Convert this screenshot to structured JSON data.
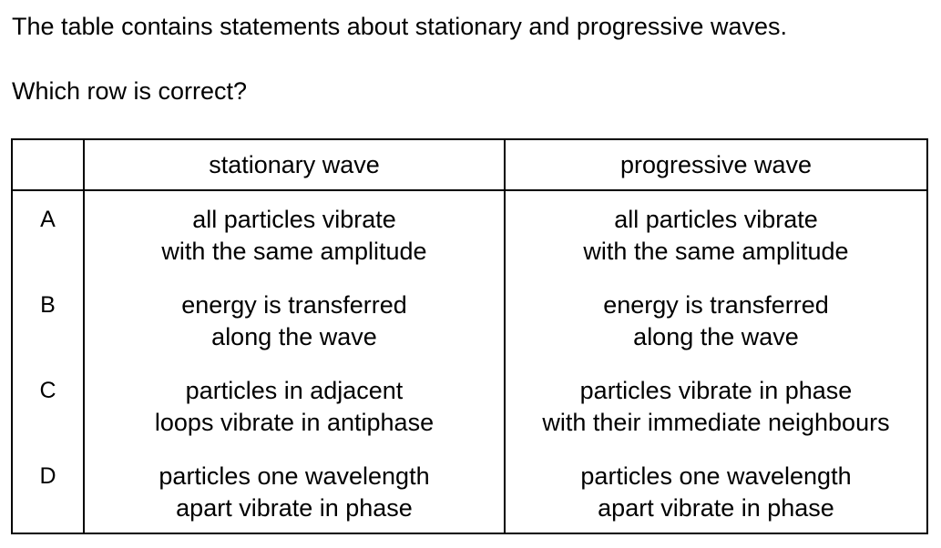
{
  "intro": "The table contains statements about stationary and progressive waves.",
  "question": "Which row is correct?",
  "table": {
    "headers": [
      "",
      "stationary wave",
      "progressive wave"
    ],
    "rows": [
      {
        "letter": "A",
        "stationary": [
          "all particles vibrate",
          "with the same amplitude"
        ],
        "progressive": [
          "all particles vibrate",
          "with the same amplitude"
        ]
      },
      {
        "letter": "B",
        "stationary": [
          "energy is transferred",
          "along the wave"
        ],
        "progressive": [
          "energy is transferred",
          "along the wave"
        ]
      },
      {
        "letter": "C",
        "stationary": [
          "particles in adjacent",
          "loops vibrate in antiphase"
        ],
        "progressive": [
          "particles vibrate in phase",
          "with their immediate neighbours"
        ]
      },
      {
        "letter": "D",
        "stationary": [
          "particles one wavelength",
          "apart vibrate in phase"
        ],
        "progressive": [
          "particles one wavelength",
          "apart vibrate in phase"
        ]
      }
    ]
  }
}
